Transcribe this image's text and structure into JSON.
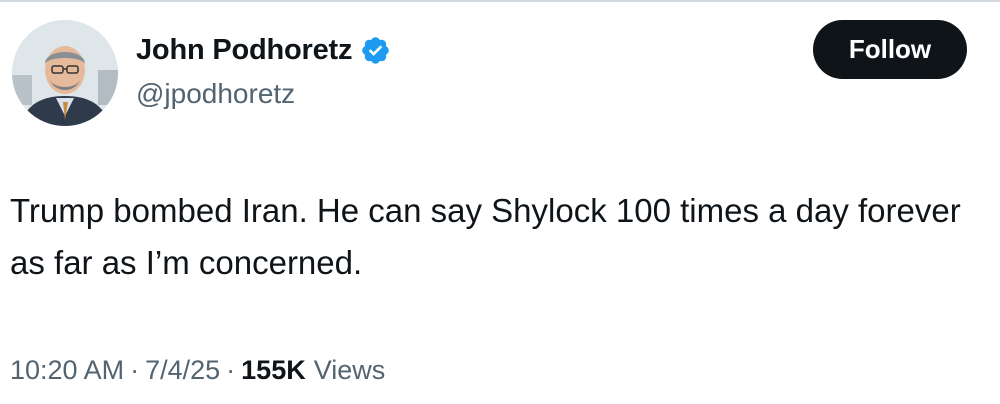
{
  "author": {
    "display_name": "John Podhoretz",
    "handle": "@jpodhoretz",
    "verified_icon": "verified-badge-icon"
  },
  "actions": {
    "follow_label": "Follow"
  },
  "tweet": {
    "text": "Trump bombed Iran. He can say Shylock 100 times a day forever as far as I’m concerned."
  },
  "meta": {
    "time": "10:20 AM",
    "separator": "·",
    "date": "7/4/25",
    "views_count": "155K",
    "views_label": "Views"
  },
  "colors": {
    "verified": "#1d9bf0",
    "follow_bg": "#0f1419",
    "secondary_text": "#536471"
  }
}
